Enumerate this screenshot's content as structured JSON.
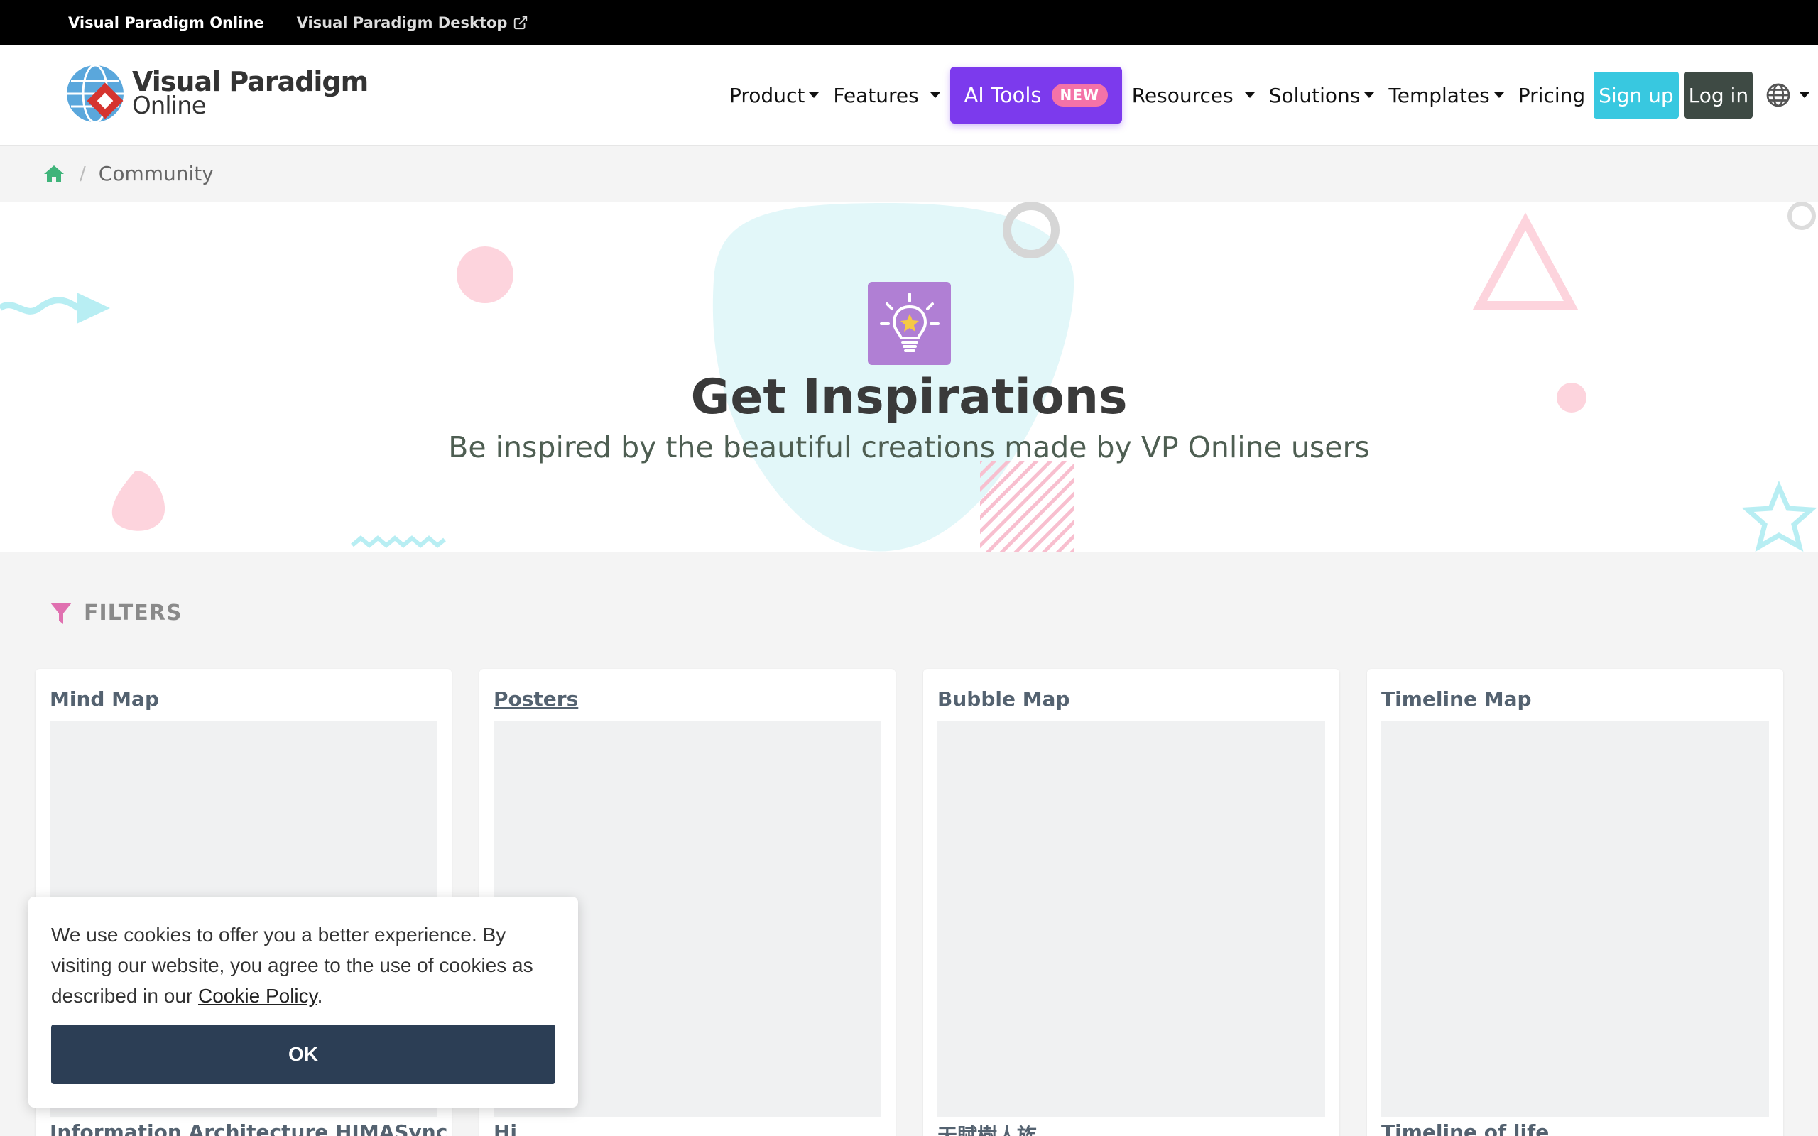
{
  "topbar": {
    "link_online": "Visual Paradigm Online",
    "link_desktop": "Visual Paradigm Desktop"
  },
  "logo": {
    "line1": "Visual Paradigm",
    "line2": "Online"
  },
  "nav": {
    "product": "Product",
    "features": "Features",
    "ai_tools": "AI Tools",
    "ai_badge": "NEW",
    "resources": "Resources",
    "solutions": "Solutions",
    "templates": "Templates",
    "pricing": "Pricing",
    "signup": "Sign up",
    "login": "Log in"
  },
  "breadcrumb": {
    "current": "Community"
  },
  "hero": {
    "title": "Get Inspirations",
    "subtitle": "Be inspired by the beautiful creations made by VP Online users"
  },
  "filters": {
    "label": "FILTERS"
  },
  "cards": [
    {
      "title": "Mind Map",
      "caption": "Information Architecture HIMASync"
    },
    {
      "title": "Posters",
      "caption": "Hi"
    },
    {
      "title": "Bubble Map",
      "caption": "天賦樹人族"
    },
    {
      "title": "Timeline Map",
      "caption": "Timeline of life"
    }
  ],
  "cookie": {
    "text_before": "We use cookies to offer you a better experience. By visiting our website, you agree to the use of cookies as described in our ",
    "link": "Cookie Policy",
    "text_after": ".",
    "ok": "OK"
  },
  "colors": {
    "ai_button": "#7c3aed",
    "signup": "#38c8e0",
    "login": "#3e4a44",
    "cookie_ok": "#2c3e55",
    "home_icon": "#3fb47a",
    "filter_icon": "#e070b0"
  }
}
